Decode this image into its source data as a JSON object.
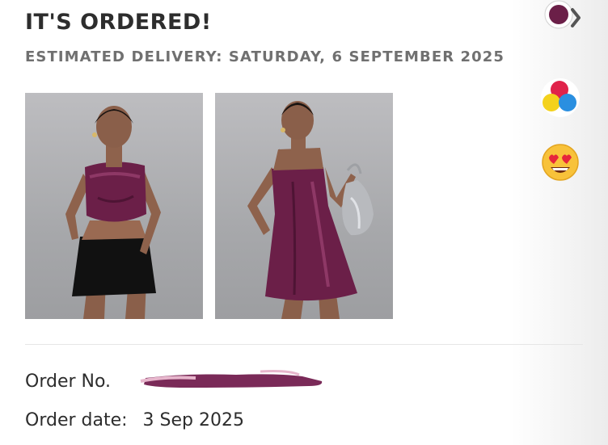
{
  "header": {
    "title": "IT'S ORDERED!",
    "estimated_delivery": "ESTIMATED DELIVERY: SATURDAY, 6 SEPTEMBER 2025"
  },
  "order": {
    "order_no_label": "Order No.",
    "order_date_label": "Order date:",
    "order_date_value": "3 Sep 2025"
  },
  "products": [
    {
      "item": "Burgundy satin corset top with black mini skirt"
    },
    {
      "item": "Burgundy satin mini dress with silver bag"
    }
  ],
  "floating_buttons": [
    {
      "icon": "avatar-chevron-icon"
    },
    {
      "icon": "color-palette-icon"
    },
    {
      "icon": "heart-eyes-emoji-icon"
    }
  ],
  "colors": {
    "text": "#2d2d2d",
    "subtext": "#707070",
    "satin": "#6b1f48",
    "redaction": "#7a2a58"
  }
}
